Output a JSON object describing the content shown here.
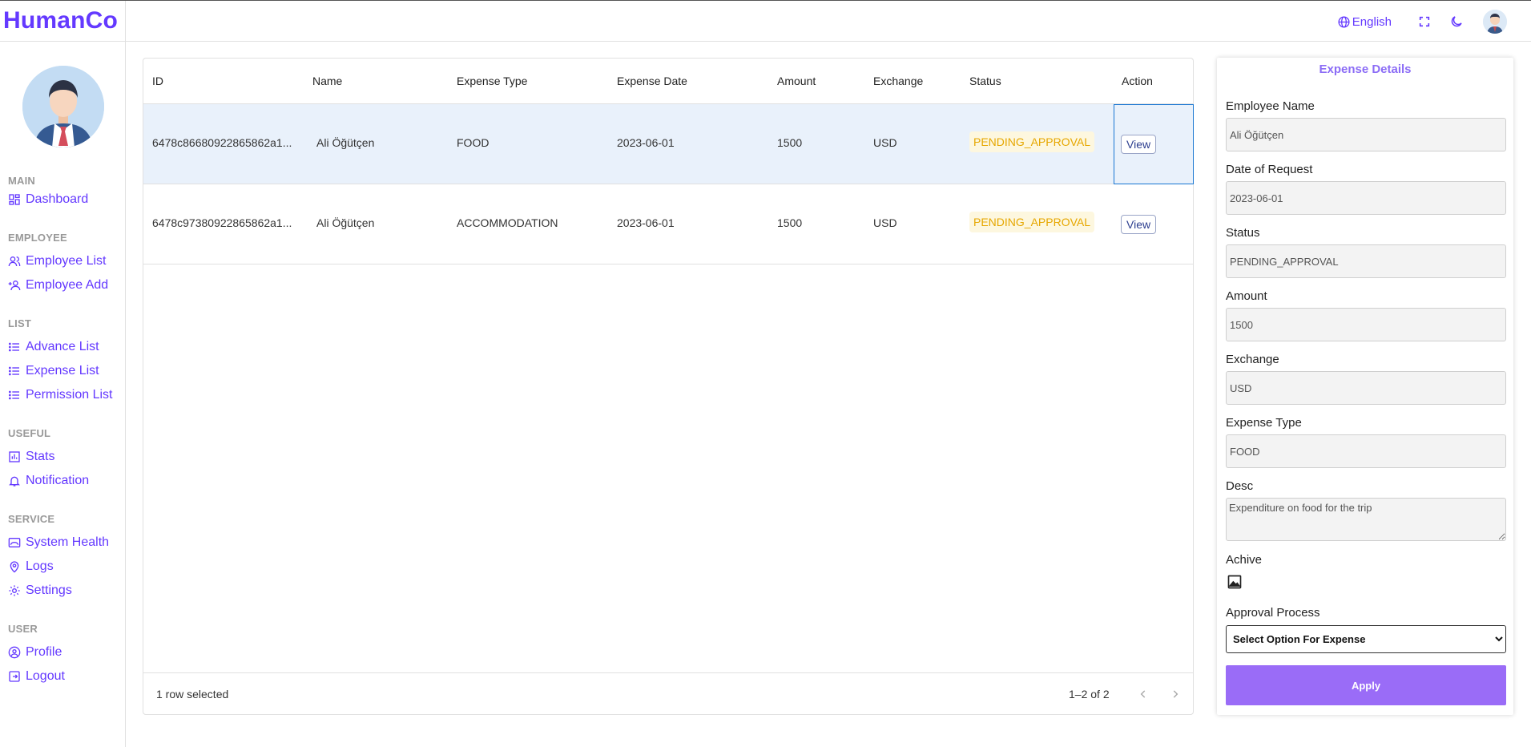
{
  "app": {
    "logo": "HumanCo",
    "brand_color": "#6439ff"
  },
  "topbar": {
    "language": "English",
    "icons": [
      "globe-icon",
      "fullscreen-icon",
      "dark-mode-icon",
      "user-avatar"
    ]
  },
  "sidebar": {
    "sections": [
      {
        "title": "MAIN",
        "items": [
          {
            "label": "Dashboard",
            "icon": "dashboard-icon"
          }
        ]
      },
      {
        "title": "EMPLOYEE",
        "items": [
          {
            "label": "Employee List",
            "icon": "people-icon"
          },
          {
            "label": "Employee Add",
            "icon": "person-add-icon"
          }
        ]
      },
      {
        "title": "LIST",
        "items": [
          {
            "label": "Advance List",
            "icon": "list-icon"
          },
          {
            "label": "Expense List",
            "icon": "list-icon"
          },
          {
            "label": "Permission List",
            "icon": "list-icon"
          }
        ]
      },
      {
        "title": "USEFUL",
        "items": [
          {
            "label": "Stats",
            "icon": "chart-icon"
          },
          {
            "label": "Notification",
            "icon": "bell-icon"
          }
        ]
      },
      {
        "title": "SERVICE",
        "items": [
          {
            "label": "System Health",
            "icon": "health-icon"
          },
          {
            "label": "Logs",
            "icon": "logs-icon"
          },
          {
            "label": "Settings",
            "icon": "gear-icon"
          }
        ]
      },
      {
        "title": "USER",
        "items": [
          {
            "label": "Profile",
            "icon": "profile-icon"
          },
          {
            "label": "Logout",
            "icon": "logout-icon"
          }
        ]
      }
    ]
  },
  "table": {
    "columns": [
      "ID",
      "Name",
      "Expense Type",
      "Expense Date",
      "Amount",
      "Exchange",
      "Status",
      "Action"
    ],
    "rows": [
      {
        "id": "6478c86680922865862a1...",
        "name": "Ali Öğütçen",
        "type": "FOOD",
        "date": "2023-06-01",
        "amount": "1500",
        "exchange": "USD",
        "status": "PENDING_APPROVAL",
        "action": "View",
        "selected": true
      },
      {
        "id": "6478c97380922865862a1...",
        "name": "Ali Öğütçen",
        "type": "ACCOMMODATION",
        "date": "2023-06-01",
        "amount": "1500",
        "exchange": "USD",
        "status": "PENDING_APPROVAL",
        "action": "View",
        "selected": false
      }
    ],
    "footer": {
      "selected_text": "1 row selected",
      "page_info": "1–2 of 2"
    },
    "status_color": "#e6a700"
  },
  "detail": {
    "title": "Expense Details",
    "fields": {
      "employee_name": {
        "label": "Employee Name",
        "value": "Ali Öğütçen"
      },
      "date_of_request": {
        "label": "Date of Request",
        "value": "2023-06-01"
      },
      "status": {
        "label": "Status",
        "value": "PENDING_APPROVAL"
      },
      "amount": {
        "label": "Amount",
        "value": "1500"
      },
      "exchange": {
        "label": "Exchange",
        "value": "USD"
      },
      "expense_type": {
        "label": "Expense Type",
        "value": "FOOD"
      },
      "desc": {
        "label": "Desc",
        "value": "Expenditure on food for the trip"
      }
    },
    "archive_label": "Achive",
    "approval": {
      "label": "Approval Process",
      "selected": "Select Option For Expense"
    },
    "apply_label": "Apply",
    "accent_color": "#9a6cf7"
  }
}
